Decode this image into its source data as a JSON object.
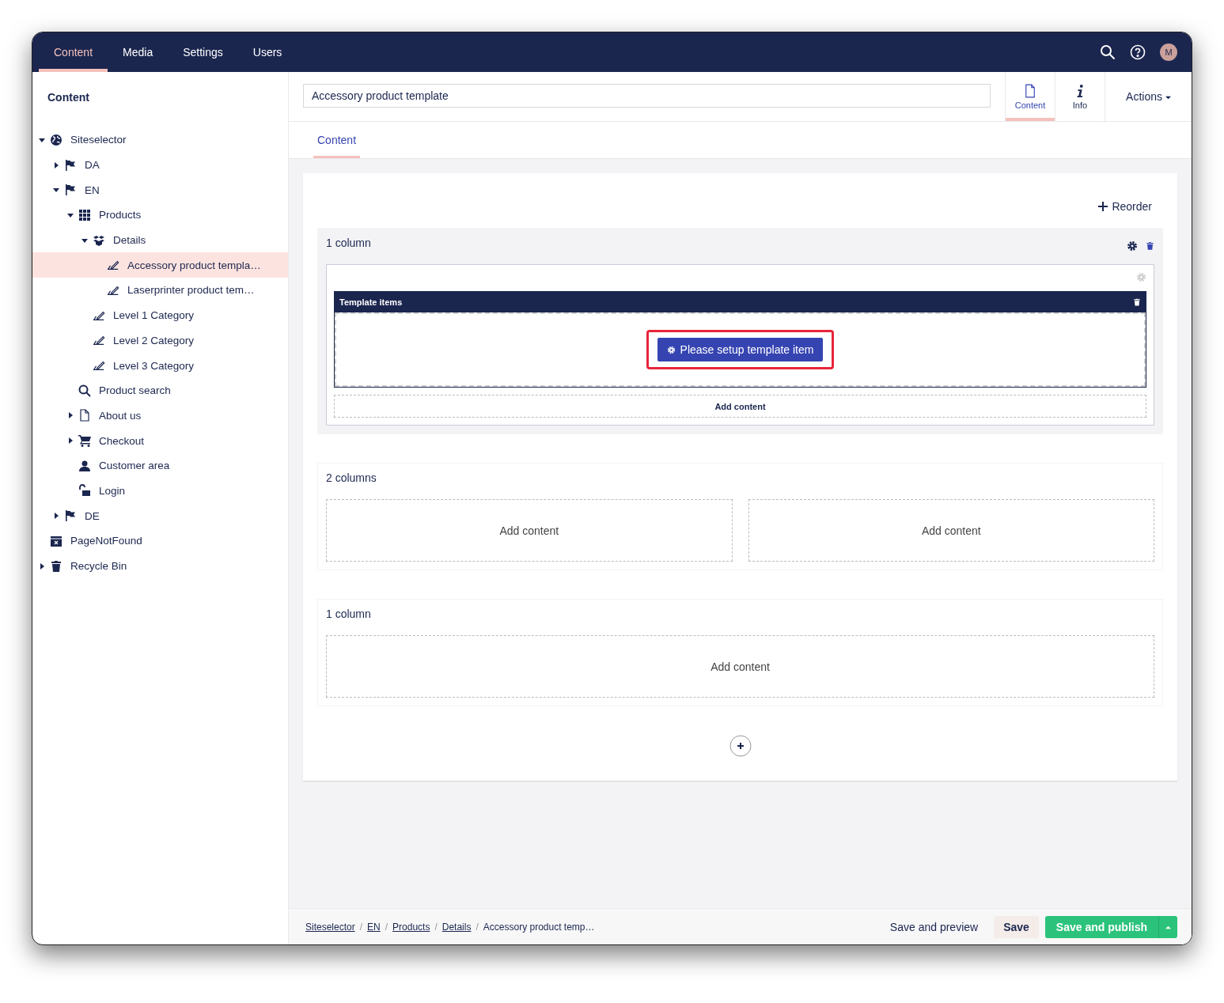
{
  "top_nav": {
    "sections": [
      {
        "label": "Content",
        "selected": true
      },
      {
        "label": "Media",
        "selected": false
      },
      {
        "label": "Settings",
        "selected": false
      },
      {
        "label": "Users",
        "selected": false
      }
    ],
    "avatar": "M"
  },
  "sidebar": {
    "title": "Content",
    "tree": [
      {
        "label": "Siteselector",
        "kind": "globe",
        "expanded": true,
        "selected": false,
        "children": [
          {
            "label": "DA",
            "kind": "flag",
            "expanded": false,
            "selected": false
          },
          {
            "label": "EN",
            "kind": "flag",
            "expanded": true,
            "selected": false,
            "children": [
              {
                "label": "Products",
                "kind": "grid",
                "expanded": true,
                "selected": false,
                "children": [
                  {
                    "label": "Details",
                    "kind": "boxes",
                    "expanded": true,
                    "selected": false,
                    "children": [
                      {
                        "label": "Accessory product templa…",
                        "kind": "edit",
                        "selected": true
                      },
                      {
                        "label": "Laserprinter product tem…",
                        "kind": "edit",
                        "selected": false
                      }
                    ]
                  },
                  {
                    "label": "Level 1 Category",
                    "kind": "edit",
                    "selected": false
                  },
                  {
                    "label": "Level 2 Category",
                    "kind": "edit",
                    "selected": false
                  },
                  {
                    "label": "Level 3 Category",
                    "kind": "edit",
                    "selected": false
                  }
                ]
              },
              {
                "label": "Product search",
                "kind": "search",
                "selected": false
              },
              {
                "label": "About us",
                "kind": "page",
                "expanded": false,
                "selected": false
              },
              {
                "label": "Checkout",
                "kind": "cart",
                "expanded": false,
                "selected": false
              },
              {
                "label": "Customer area",
                "kind": "user",
                "selected": false
              },
              {
                "label": "Login",
                "kind": "lock",
                "selected": false
              }
            ]
          },
          {
            "label": "DE",
            "kind": "flag",
            "expanded": false,
            "selected": false
          }
        ]
      },
      {
        "label": "PageNotFound",
        "kind": "notfound",
        "selected": false
      },
      {
        "label": "Recycle Bin",
        "kind": "trash",
        "expanded": false,
        "selected": false
      }
    ]
  },
  "editor": {
    "name": "Accessory product template",
    "apps": [
      {
        "label": "Content",
        "kind": "document",
        "selected": true
      },
      {
        "label": "Info",
        "kind": "info",
        "selected": false
      }
    ],
    "actions": "Actions",
    "tabs": [
      {
        "label": "Content",
        "selected": true
      }
    ]
  },
  "grid": {
    "reorder": "Reorder",
    "rows": [
      {
        "title": "1 column",
        "active": true,
        "cells": [
          {
            "kind": "editor",
            "header": "Template items",
            "setup": "Please setup template item",
            "highlighted": true,
            "add": "Add content"
          }
        ]
      },
      {
        "title": "2 columns",
        "active": false,
        "cells": [
          {
            "kind": "empty",
            "add": "Add content"
          },
          {
            "kind": "empty",
            "add": "Add content"
          }
        ]
      },
      {
        "title": "1 column",
        "active": false,
        "cells": [
          {
            "kind": "empty",
            "add": "Add content"
          }
        ]
      }
    ]
  },
  "footer": {
    "breadcrumb": [
      {
        "label": "Siteselector",
        "link": true
      },
      {
        "label": "EN",
        "link": true
      },
      {
        "label": "Products",
        "link": true
      },
      {
        "label": "Details",
        "link": true
      },
      {
        "label": "Accessory product temp…",
        "link": false
      }
    ],
    "separators": [
      "/",
      "/",
      "/",
      "/"
    ],
    "preview": "Save and preview",
    "save": "Save",
    "publish": "Save and publish"
  }
}
